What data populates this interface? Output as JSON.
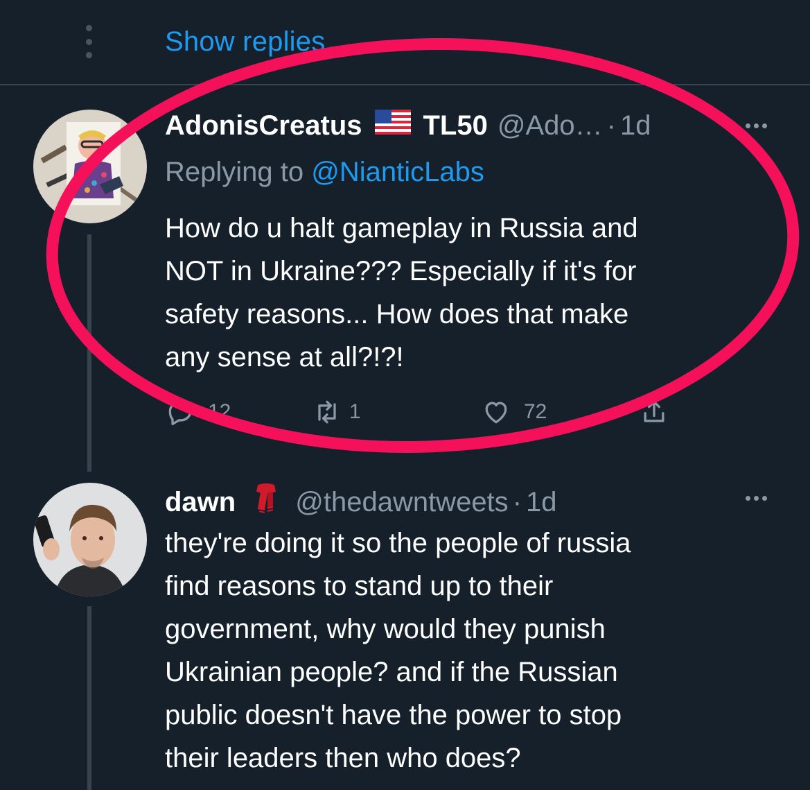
{
  "top": {
    "show_replies": "Show replies"
  },
  "tweet1": {
    "display_name": "AdonisCreatus",
    "flag": "🇺🇸",
    "badge_text": "TL50",
    "handle": "@Ado…",
    "separator": "·",
    "time": "1d",
    "replying_prefix": "Replying to ",
    "replying_mention": "@NianticLabs",
    "text_lines": [
      "How do u halt gameplay in Russia and",
      "NOT in Ukraine??? Especially if it's for",
      "safety reasons... How does that make",
      "any sense at all?!?!"
    ],
    "reply_count": "12",
    "retweet_count": "1",
    "like_count": "72"
  },
  "tweet2": {
    "display_name": "dawn",
    "emoji": "🧣",
    "handle": "@thedawntweets",
    "separator": "·",
    "time": "1d",
    "text_lines": [
      "they're doing it so the people of russia",
      "find reasons to stand up to their",
      "government, why would they punish",
      "Ukrainian people? and if the Russian",
      "public doesn't have the power to stop",
      "their leaders then who does?"
    ]
  },
  "colors": {
    "background": "#15202b",
    "link": "#1d9bf0",
    "secondary_text": "#8b98a5",
    "annotation_ellipse": "#f5115a"
  },
  "icons": [
    "more-vertical-icon",
    "more-horizontal-icon",
    "reply-icon",
    "retweet-icon",
    "like-icon",
    "share-icon",
    "flag-us-icon",
    "scarf-emoji-icon"
  ]
}
